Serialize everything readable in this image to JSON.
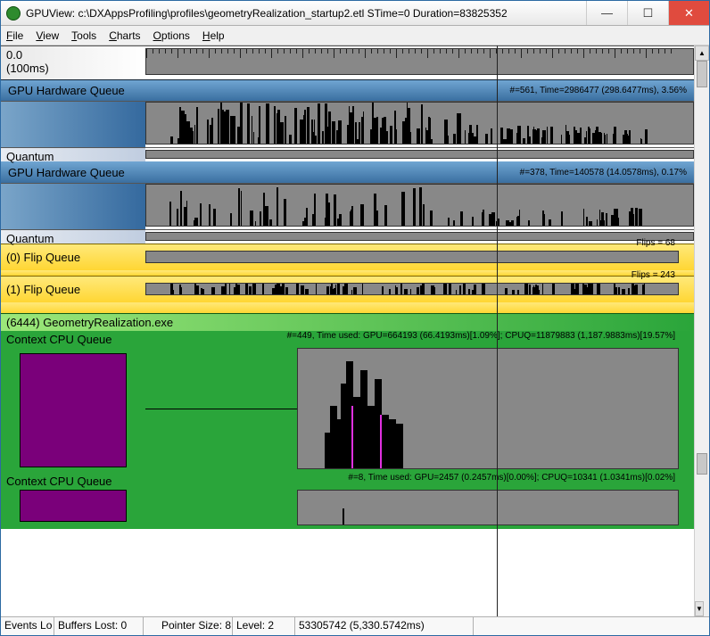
{
  "window": {
    "title": "GPUView: c:\\DXAppsProfiling\\profiles\\geometryRealization_startup2.etl  STime=0 Duration=83825352"
  },
  "menu": {
    "file": "File",
    "view": "View",
    "tools": "Tools",
    "charts": "Charts",
    "options": "Options",
    "help": "Help"
  },
  "ruler": {
    "start": "0.0",
    "granularity": "(100ms)"
  },
  "gpu_queue_1": {
    "title": "GPU Hardware Queue",
    "stats": "#=561,  Time=2986477 (298.6477ms),  3.56%",
    "quantum": "Quantum"
  },
  "gpu_queue_2": {
    "title": "GPU Hardware Queue",
    "stats": "#=378,  Time=140578 (14.0578ms),  0.17%",
    "quantum": "Quantum"
  },
  "flip0": {
    "label": "(0) Flip Queue",
    "stats": "Flips = 68"
  },
  "flip1": {
    "label": "(1) Flip Queue",
    "stats": "Flips = 243"
  },
  "process": {
    "title": "(6444) GeometryRealization.exe",
    "ctx1_label": "Context CPU Queue",
    "ctx1_stats": "#=449, Time used: GPU=664193 (66.4193ms)[1.09%]; CPUQ=11879883 (1,187.9883ms)[19.57%]",
    "ctx2_label": "Context CPU Queue",
    "ctx2_stats": "#=8, Time used: GPU=2457 (0.2457ms)[0.00%]; CPUQ=10341 (1.0341ms)[0.02%]"
  },
  "status": {
    "events": "Events Lo",
    "buffers": "Buffers Lost: 0",
    "ptr": "Pointer Size: 8",
    "level": "Level: 2",
    "pos": "53305742 (5,330.5742ms)"
  }
}
